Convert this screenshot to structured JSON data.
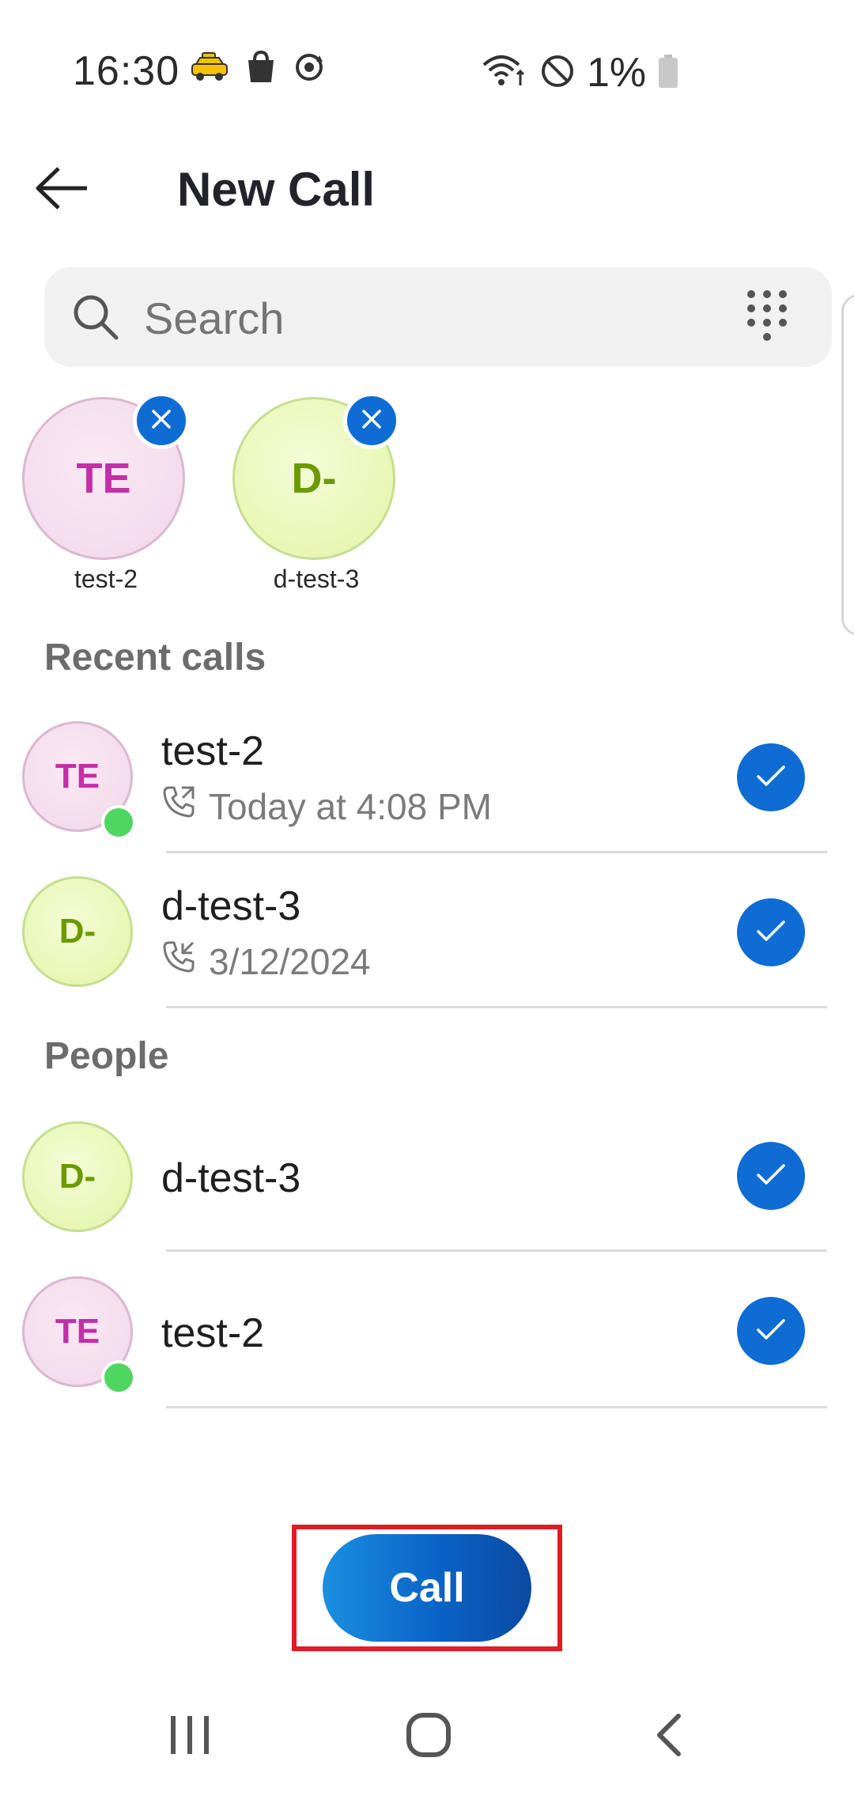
{
  "status_bar": {
    "time": "16:30",
    "battery_percent": "1%",
    "left_icons": [
      "taxi-icon",
      "shopping-bag-icon",
      "sync-icon"
    ],
    "right_icons": [
      "wifi-icon",
      "do-not-disturb-icon",
      "battery-icon"
    ]
  },
  "header": {
    "title": "New Call",
    "back_icon": "arrow-left-icon"
  },
  "search": {
    "placeholder": "Search",
    "value": "",
    "dialpad_icon": "dialpad-icon"
  },
  "selected": [
    {
      "initials": "TE",
      "name": "test-2"
    },
    {
      "initials": "D-",
      "name": "d-test-3"
    }
  ],
  "recent_calls": {
    "title": "Recent calls",
    "items": [
      {
        "initials": "TE",
        "name": "test-2",
        "detail": "Today at 4:08 PM",
        "call_direction": "outgoing",
        "online": true,
        "selected": true
      },
      {
        "initials": "D-",
        "name": "d-test-3",
        "detail": "3/12/2024",
        "call_direction": "incoming",
        "online": false,
        "selected": true
      }
    ]
  },
  "people": {
    "title": "People",
    "items": [
      {
        "initials": "D-",
        "name": "d-test-3",
        "online": false,
        "selected": true
      },
      {
        "initials": "TE",
        "name": "test-2",
        "online": true,
        "selected": true
      }
    ]
  },
  "actions": {
    "call_label": "Call"
  },
  "colors": {
    "accent": "#0f6cd3",
    "presence_online": "#4fd660",
    "te_initials": "#c22fa6",
    "d_initials": "#6d9a00",
    "highlight": "#e31b23"
  }
}
